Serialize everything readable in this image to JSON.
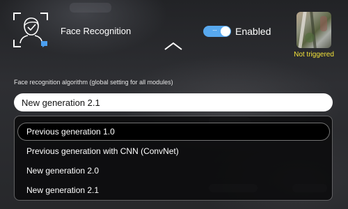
{
  "module": {
    "title": "Face Recognition",
    "icon": "face-recognition-icon"
  },
  "toggle": {
    "label": "Enabled",
    "state": "on",
    "color": "#58a8ee"
  },
  "preview": {
    "status": "Not triggered",
    "status_color": "#f3e33a"
  },
  "algorithm": {
    "label": "Face recognition algorithm (global setting for all modules)",
    "value": "New generation 2.1",
    "options": [
      "Previous generation 1.0",
      "Previous generation with CNN (ConvNet)",
      "New generation 2.0",
      "New generation 2.1"
    ],
    "highlighted_index": 0
  }
}
